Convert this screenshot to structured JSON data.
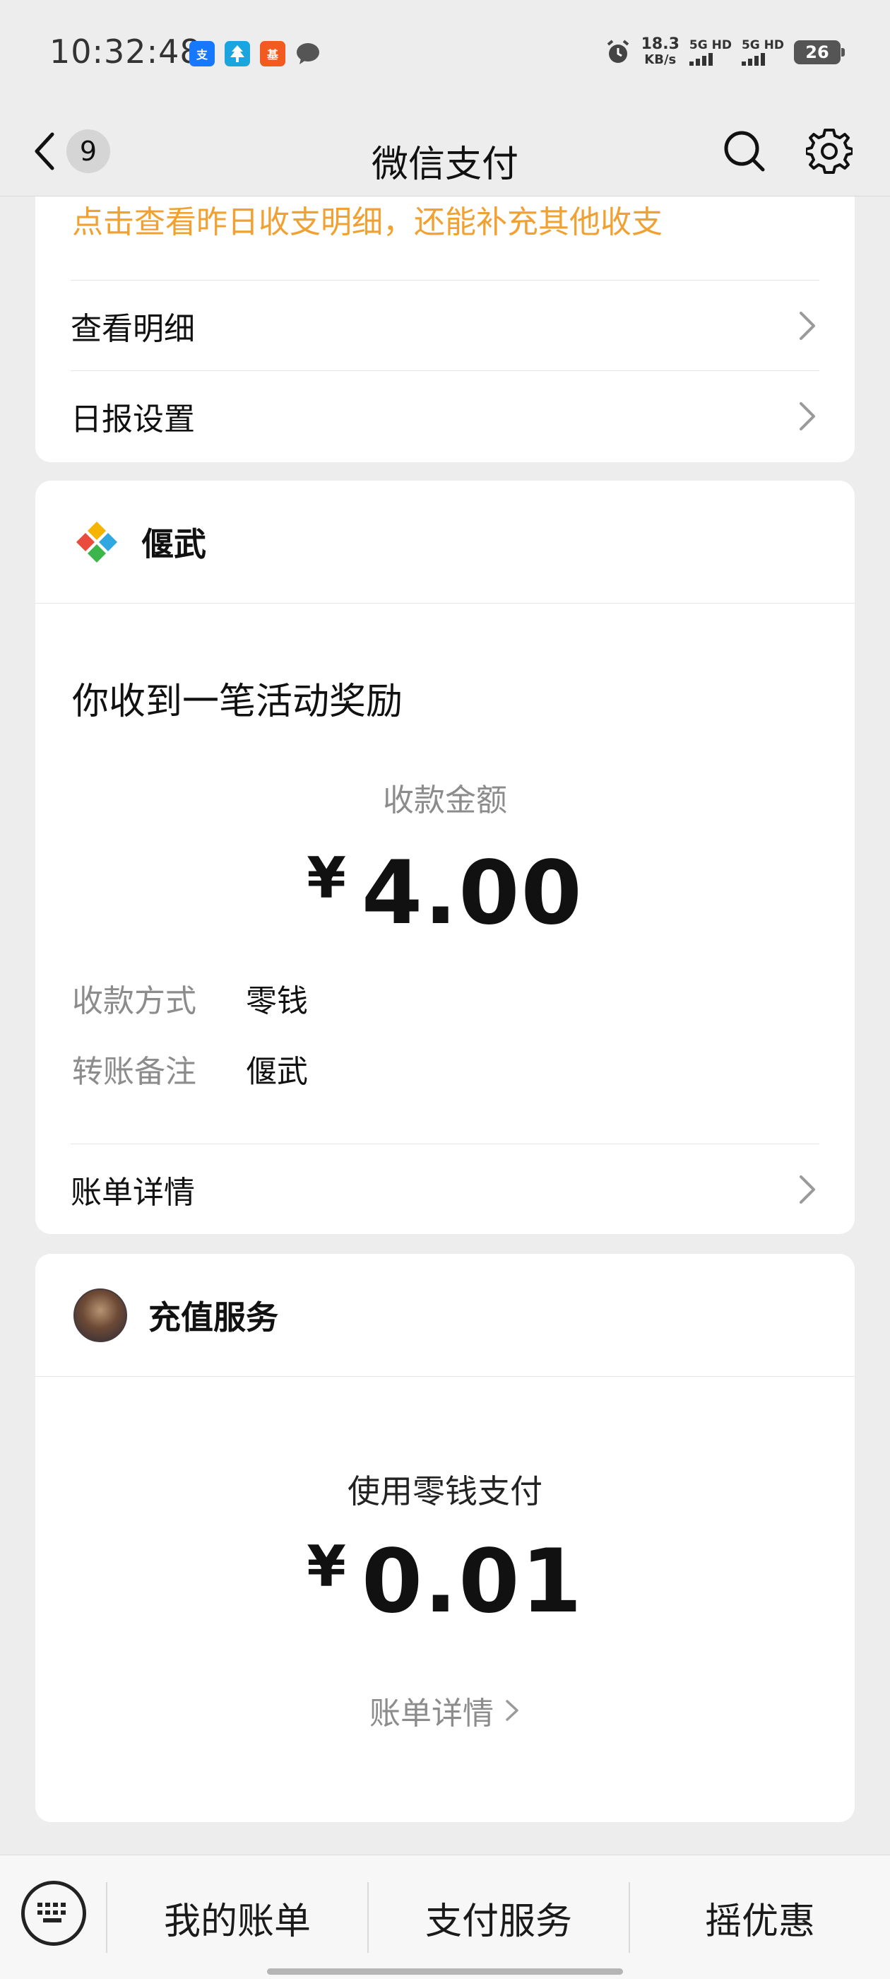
{
  "status_bar": {
    "time": "10:32:48",
    "net_speed_value": "18.3",
    "net_speed_unit": "KB/s",
    "sim1_label": "5G HD",
    "sim2_label": "5G HD",
    "battery": "26",
    "notif_alipay": "支",
    "notif_fund": "基"
  },
  "nav": {
    "title": "微信支付",
    "unread_count": "9"
  },
  "daily_card": {
    "orange_text": "点击查看昨日收支明细，还能补充其他收支",
    "view_details": "查看明细",
    "report_settings": "日报设置"
  },
  "reward_card": {
    "sender": "偃武",
    "message_title": "你收到一笔活动奖励",
    "amount_label": "收款金额",
    "currency": "¥",
    "amount": "4.00",
    "method_key": "收款方式",
    "method_value": "零钱",
    "note_key": "转账备注",
    "note_value": "偃武",
    "bill_details": "账单详情"
  },
  "recharge_card": {
    "title": "充值服务",
    "pay_label": "使用零钱支付",
    "currency": "¥",
    "amount": "0.01",
    "bill_details": "账单详情"
  },
  "bottom_menu": {
    "item1": "我的账单",
    "item2": "支付服务",
    "item3": "摇优惠"
  },
  "colors": {
    "accent_orange": "#f0a132",
    "background": "#ededed",
    "card": "#ffffff",
    "muted_text": "#8c8c8c"
  }
}
